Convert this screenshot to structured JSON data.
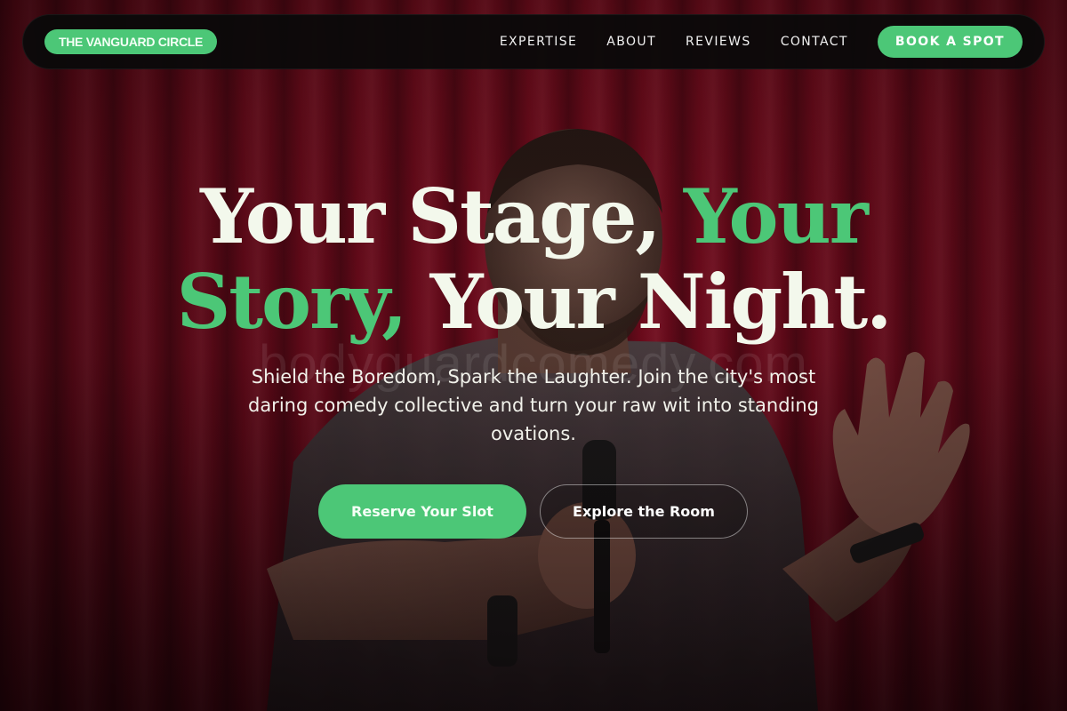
{
  "brand": {
    "name": "THE VANGUARD CIRCLE"
  },
  "nav": {
    "links": [
      {
        "label": "EXPERTISE"
      },
      {
        "label": "ABOUT"
      },
      {
        "label": "REVIEWS"
      },
      {
        "label": "CONTACT"
      }
    ],
    "cta_label": "BOOK A SPOT"
  },
  "hero": {
    "headline": {
      "line1_main": "Your Stage, ",
      "line1_accent": "Your",
      "line2_accent": "Story, ",
      "line2_main": "Your Night."
    },
    "watermark": "bodyguardcomedy.com",
    "subtitle": "Shield the Boredom, Spark the Laughter. Join the city's most daring comedy collective and turn your raw wit into standing ovations.",
    "primary_cta": "Reserve Your Slot",
    "secondary_cta": "Explore the Room"
  },
  "colors": {
    "accent": "#4cc777",
    "curtain": "#7a0c1f",
    "nav_bg": "#0a0a0a",
    "headline": "#f3f8ec"
  }
}
